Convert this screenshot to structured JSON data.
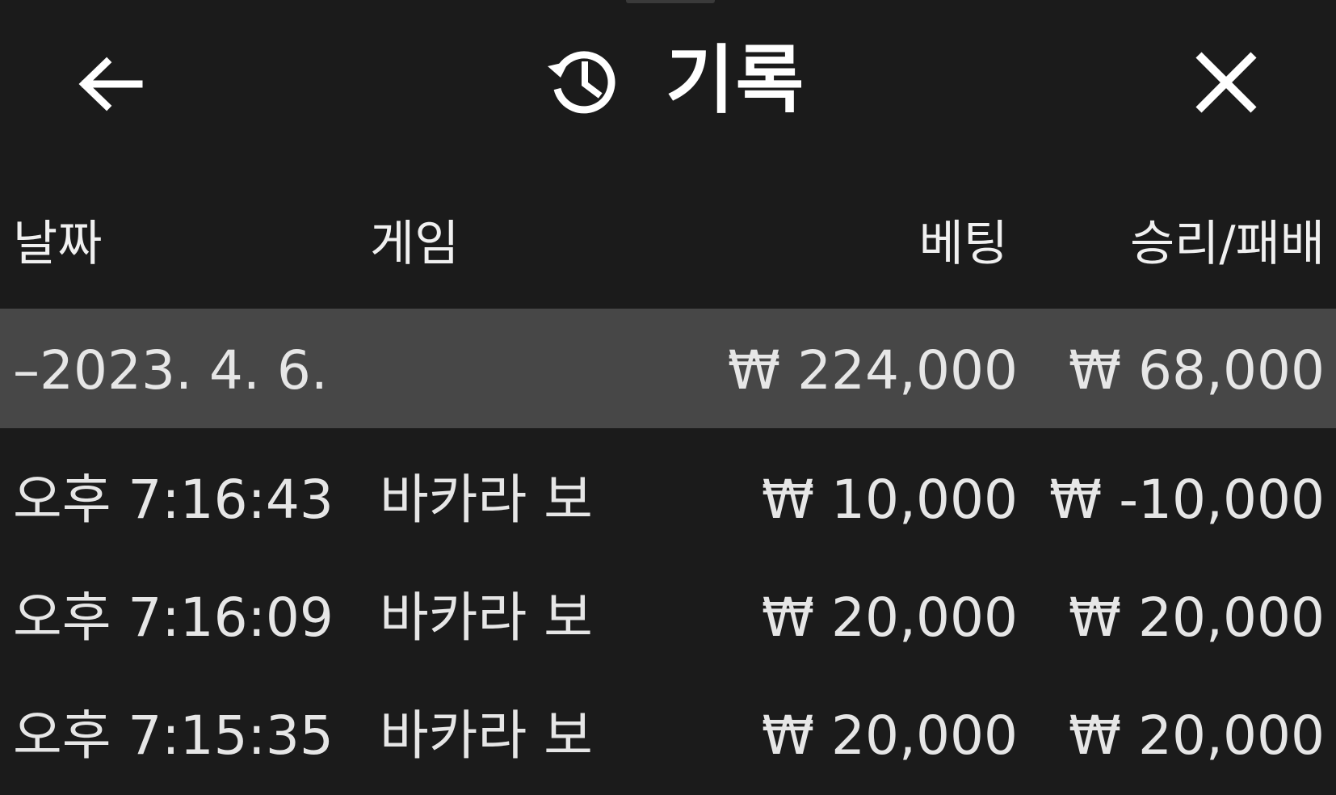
{
  "header": {
    "title": "기록",
    "back_icon": "arrow-left-icon",
    "history_icon": "history-clock-icon",
    "close_icon": "close-icon"
  },
  "columns": {
    "date": "날짜",
    "game": "게임",
    "bet": "베팅",
    "result": "승리/패배"
  },
  "group": {
    "date": "–2023. 4. 6.",
    "bet": "₩ 224,000",
    "result": "₩ 68,000"
  },
  "rows": [
    {
      "time": "오후 7:16:43",
      "game": "바카라 보",
      "bet": "₩ 10,000",
      "result": "₩ -10,000"
    },
    {
      "time": "오후 7:16:09",
      "game": "바카라 보",
      "bet": "₩ 20,000",
      "result": "₩ 20,000"
    },
    {
      "time": "오후 7:15:35",
      "game": "바카라 보",
      "bet": "₩ 20,000",
      "result": "₩ 20,000"
    }
  ],
  "colors": {
    "background": "#1b1b1b",
    "group_row": "#474747",
    "text": "#e6e6e6"
  }
}
